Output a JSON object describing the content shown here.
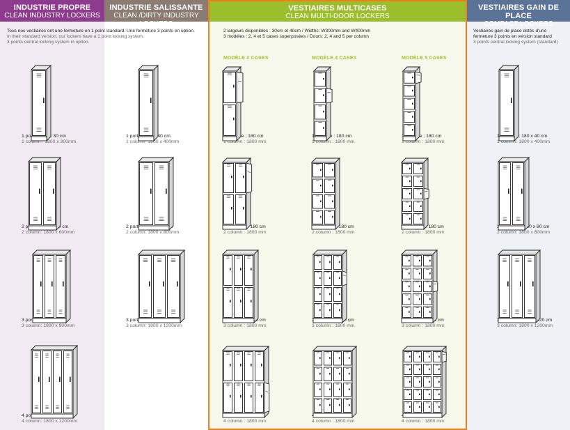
{
  "columns": {
    "c1": {
      "title": "INDUSTRIE PROPRE",
      "subtitle": "CLEAN INDUSTRY LOCKERS",
      "intro_fr": "Tous nos vestiaires ont une fermeture en 1 point standard. Une fermeture 3 points en option.",
      "intro_en1": "In their standard version, our lockers have a 1 point locking system.",
      "intro_en2": "3 points central locking system in option.",
      "items": [
        {
          "fr": "1 porte : 180 x 30 cm",
          "en": "1 column : 1800 x 300mm"
        },
        {
          "fr": "2 portes : 180 x 60 cm",
          "en": "2 column: 1800 x 600mm"
        },
        {
          "fr": "3 portes : 180 x 90 cm",
          "en": "3 column: 1800 x 900mm"
        },
        {
          "fr": "4 portes : 180 x 120 cm",
          "en": "4 column: 1800 x 1200mm"
        }
      ]
    },
    "c2": {
      "title": "INDUSTRIE SALISSANTE",
      "subtitle": "CLEAN /DIRTY INDUSTRY LOCKERS",
      "items": [
        {
          "fr": "1 porte : 180 x 40 cm",
          "en": "1 column: 1800 x 400mm"
        },
        {
          "fr": "2 portes : 180 x 80 cm",
          "en": "2 column: 1800 x 800mm"
        },
        {
          "fr": "3 portes : 180 x 120 cm",
          "en": "3 column: 1800 x 1200mm"
        }
      ]
    },
    "c3": {
      "title": "VESTIAIRES MULTICASES",
      "subtitle": "CLEAN MULTI-DOOR LOCKERS",
      "intro1": "2 largeurs disponibles : 30cm et 40cm / Widths: W300mm and W400mm",
      "intro2": "3 modèles : 2, 4 et 5 cases superposées / Doors: 2, 4 and 5 per column",
      "models": [
        "MODÈLE 2 CASES",
        "MODÈLE 4 CASES",
        "MODÈLE 5 CASES"
      ],
      "items": [
        {
          "fr": "1 colonne : 180 cm",
          "en": "1 column : 1800 mm"
        },
        {
          "fr": "2 colonnes : 180 cm",
          "en": "2 column : 1800 mm"
        },
        {
          "fr": "3 colonnes : 180 cm",
          "en": "3 column : 1800 mm"
        },
        {
          "fr": "4 colonnes : 180 cm",
          "en": "4 column : 1800 mm"
        }
      ]
    },
    "c4": {
      "title": "VESTIAIRES GAIN DE PLACE",
      "subtitle": "COMPACT LOCKERS",
      "intro1": "Vestiaires gain de place dotés d'une",
      "intro2": "fermeture 3 points en version standard",
      "intro3": "3 points central locking system (standard)",
      "items": [
        {
          "fr": "1 colonne : 180 x 40 cm",
          "en": "1 column: 1800 x 400mm"
        },
        {
          "fr": "2 colonnes : 180 x 80 cm",
          "en": "2 column: 1800 x 800mm"
        },
        {
          "fr": "3 colonnes : 180 x 120 cm",
          "en": "3 column: 1800 x 1200mm"
        }
      ]
    }
  },
  "colors": {
    "purple": "#8e3b8e",
    "purple_bg": "#f2eaf2",
    "taupe": "#8b7b73",
    "green": "#9bbe2c",
    "orange_border": "#f07f1a",
    "green_bg": "#f6f8ec",
    "blue": "#5a7397",
    "blue_bg": "#eef1f5",
    "model_label": "#a6c239"
  }
}
